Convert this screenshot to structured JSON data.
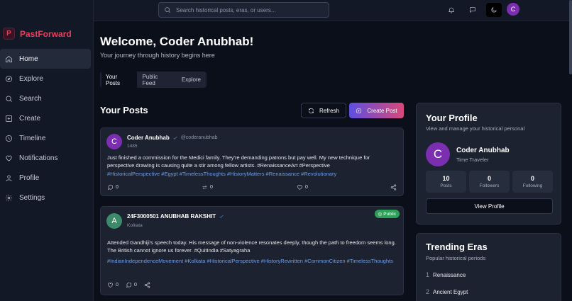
{
  "brand": {
    "logo": "P",
    "name": "PastForward"
  },
  "nav": [
    {
      "label": "Home",
      "icon": "home-icon",
      "active": true
    },
    {
      "label": "Explore",
      "icon": "compass-icon"
    },
    {
      "label": "Search",
      "icon": "search-icon"
    },
    {
      "label": "Create",
      "icon": "plus-square-icon"
    },
    {
      "label": "Timeline",
      "icon": "clock-icon"
    },
    {
      "label": "Notifications",
      "icon": "heart-icon"
    },
    {
      "label": "Profile",
      "icon": "user-icon"
    },
    {
      "label": "Settings",
      "icon": "gear-icon"
    }
  ],
  "topbar": {
    "search_placeholder": "Search historical posts, eras, or users...",
    "avatar_initial": "C"
  },
  "main": {
    "welcome": "Welcome, Coder Anubhab!",
    "subtitle": "Your journey through history begins here",
    "tabs": [
      "Your Posts",
      "Public Feed",
      "Explore"
    ],
    "section_title": "Your Posts",
    "refresh_label": "Refresh",
    "create_label": "Create Post"
  },
  "posts": [
    {
      "avatar": "C",
      "avatar_color": "#7b2fb0",
      "name": "Coder Anubhab",
      "handle": "@coderanubhab",
      "sub": "1485",
      "body": "Just finished a commission for the Medici family. They're demanding patrons but pay well. My new technique for perspective drawing is causing quite a stir among fellow artists. #RenaissanceArt #Perspective",
      "tags": "#HistoricalPerspective #Egypt #TimelessThoughts #HistoryMatters #Renaissance #Revolutionary",
      "comments": "0",
      "reposts": "0",
      "likes": "0"
    },
    {
      "avatar": "A",
      "avatar_color": "#3d8a6a",
      "name": "24F3000501 ANUBHAB RAKSHIT",
      "sub": "Kolkata",
      "badge": "Public",
      "body": "Attended Gandhiji's speech today. His message of non-violence resonates deeply, though the path to freedom seems long. The British cannot ignore us forever. #QuitIndia #Satyagraha",
      "tags": "#IndianIndependenceMovement #Kolkata #HistoricalPerspective #HistoryRewritten #CommonCitizen #TimelessThoughts",
      "likes": "0",
      "comments": "0"
    }
  ],
  "profile": {
    "title": "Your Profile",
    "subtitle": "View and manage your historical personal",
    "avatar": "C",
    "name": "Coder Anubhab",
    "role": "Time Traveler",
    "stats": [
      {
        "value": "10",
        "label": "Posts"
      },
      {
        "value": "0",
        "label": "Followers"
      },
      {
        "value": "0",
        "label": "Following"
      }
    ],
    "button": "View Profile"
  },
  "trending": {
    "title": "Trending Eras",
    "subtitle": "Popular historical periods",
    "items": [
      {
        "num": "1",
        "label": "Renaissance"
      },
      {
        "num": "2",
        "label": "Ancient Egypt"
      }
    ]
  }
}
